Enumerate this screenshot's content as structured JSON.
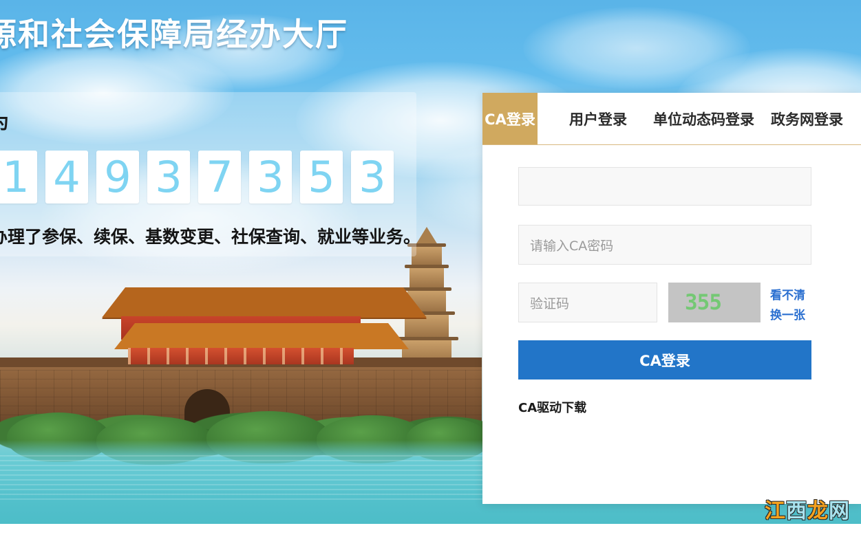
{
  "hero": {
    "site_title": "源和社会保障局经办大厅",
    "stat_lead": "为",
    "stat_digits": [
      "1",
      "4",
      "9",
      "3",
      "7",
      "3",
      "5",
      "3"
    ],
    "stat_footer": "办理了参保、续保、基数变更、社保查询、就业等业务。"
  },
  "login": {
    "tabs": [
      {
        "label": "CA登录",
        "active": true
      },
      {
        "label": "用户登录",
        "active": false
      },
      {
        "label": "单位动态码登录",
        "active": false
      },
      {
        "label": "政务网登录",
        "active": false
      }
    ],
    "fields": {
      "certificate": {
        "value": "",
        "placeholder": ""
      },
      "password": {
        "value": "",
        "placeholder": "请输入CA密码"
      },
      "captcha": {
        "value": "",
        "placeholder": "验证码"
      }
    },
    "captcha_image": {
      "text": "355",
      "bg_color": "#c4c4c4",
      "fg_color": "#74c874"
    },
    "captcha_links": [
      {
        "label": "看不清"
      },
      {
        "label": "换一张"
      }
    ],
    "submit_label": "CA登录",
    "driver_link_label": "CA驱动下载"
  },
  "watermark": {
    "part1": "江",
    "part2": "西",
    "part3": "龙",
    "part4": "网"
  },
  "colors": {
    "active_tab": "#d0a95f",
    "submit": "#2275c8",
    "link": "#2a6fd0",
    "digit": "#7fd4f2"
  }
}
